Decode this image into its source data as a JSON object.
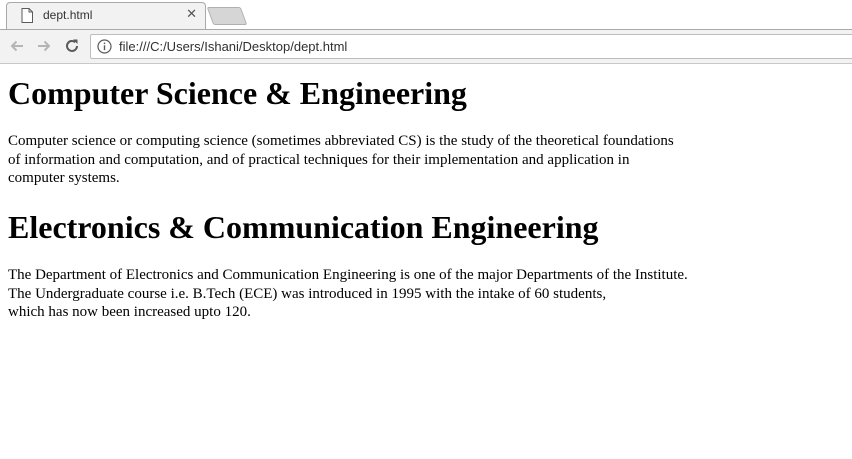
{
  "browser": {
    "tab": {
      "title": "dept.html",
      "close_glyph": "✕"
    },
    "address_bar": {
      "url": "file:///C:/Users/Ishani/Desktop/dept.html"
    },
    "icons": {
      "page": "page-icon",
      "back": "back-arrow-icon",
      "forward": "forward-arrow-icon",
      "reload": "reload-icon",
      "info": "info-icon"
    }
  },
  "content": {
    "sections": [
      {
        "heading": "Computer Science & Engineering",
        "lines": [
          "Computer science or computing science (sometimes abbreviated CS) is the study of the theoretical foundations",
          "of information and computation, and of practical techniques for their implementation and application in",
          "computer systems."
        ]
      },
      {
        "heading": "Electronics & Communication Engineering",
        "lines": [
          "The Department of Electronics and Communication Engineering is one of the major Departments of the Institute.",
          "The Undergraduate course i.e. B.Tech (ECE) was introduced in 1995 with the intake of 60 students,",
          "which has now been increased upto 120."
        ]
      }
    ]
  }
}
